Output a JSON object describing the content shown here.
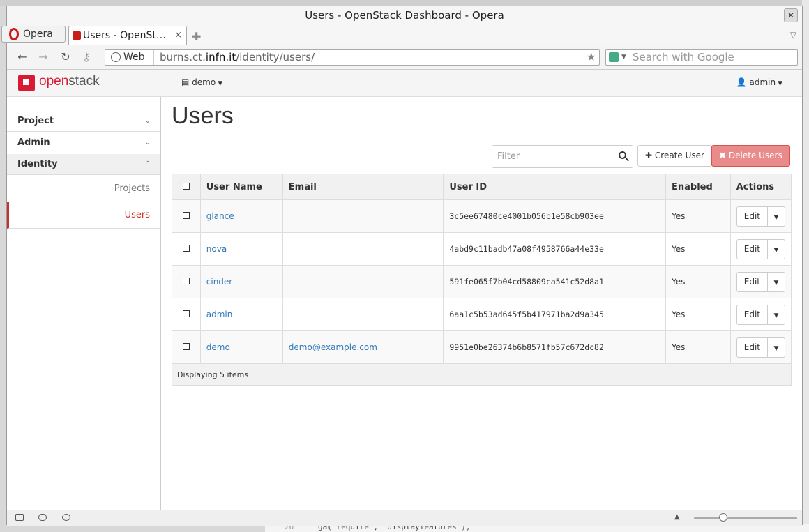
{
  "window": {
    "title": "Users - OpenStack Dashboard - Opera"
  },
  "browser": {
    "menu_label": "Opera",
    "tab_title": "Users - OpenSt…",
    "addr_mode": "Web",
    "url_prefix": "burns.ct.",
    "url_domain": "infn.it",
    "url_path": "/identity/users/",
    "search_placeholder": "Search with Google"
  },
  "navbar": {
    "brand_open": "open",
    "brand_stack": "stack",
    "project_menu": "demo",
    "user_menu": "admin"
  },
  "sidebar": {
    "sections": [
      {
        "label": "Project",
        "chevron": "chevron-down-icon"
      },
      {
        "label": "Admin",
        "chevron": "chevron-down-icon"
      },
      {
        "label": "Identity",
        "chevron": "chevron-up-icon"
      }
    ],
    "items": [
      {
        "label": "Projects",
        "current": false
      },
      {
        "label": "Users",
        "current": true
      }
    ]
  },
  "main": {
    "title": "Users",
    "filter_placeholder": "Filter",
    "create_label": "Create User",
    "delete_label": "Delete Users",
    "columns": [
      "User Name",
      "Email",
      "User ID",
      "Enabled",
      "Actions"
    ],
    "rows": [
      {
        "name": "glance",
        "email": "",
        "id": "3c5ee67480ce4001b056b1e58cb903ee",
        "enabled": "Yes",
        "action": "Edit"
      },
      {
        "name": "nova",
        "email": "",
        "id": "4abd9c11badb47a08f4958766a44e33e",
        "enabled": "Yes",
        "action": "Edit"
      },
      {
        "name": "cinder",
        "email": "",
        "id": "591fe065f7b04cd58809ca541c52d8a1",
        "enabled": "Yes",
        "action": "Edit"
      },
      {
        "name": "admin",
        "email": "",
        "id": "6aa1c5b53ad645f5b417971ba2d9a345",
        "enabled": "Yes",
        "action": "Edit"
      },
      {
        "name": "demo",
        "email": "demo@example.com",
        "id": "9951e0be26374b6b8571fb57c672dc82",
        "enabled": "Yes",
        "action": "Edit"
      }
    ],
    "footer": "Displaying 5 items"
  },
  "background": {
    "code_line_number": "26",
    "code_text": "ga('require', 'displayfeatures');"
  },
  "colors": {
    "accent": "#da1a32",
    "link": "#337ab7",
    "danger": "#e98b8a"
  }
}
